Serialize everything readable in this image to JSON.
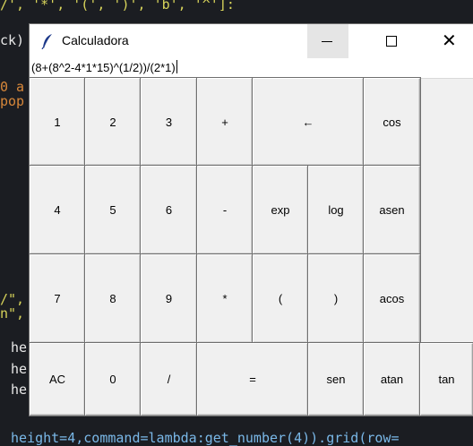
{
  "background_editor": {
    "line1": "/', '*', '(', ')', 'b', '^']:",
    "line2": "ck)",
    "line3": "0 a",
    "line4": "pop",
    "line5": "/\",",
    "line6": "n\",",
    "line7": "he",
    "line8": "he",
    "line9": "he",
    "line10": "height=4,command=lambda:get_number(4)).grid(row="
  },
  "window": {
    "title": "Calculadora",
    "close_symbol": "✕"
  },
  "display": {
    "value": "(8+(8^2-4*1*15)^(1/2))/(2*1)"
  },
  "keys": {
    "k1": "1",
    "k2": "2",
    "k3": "3",
    "plus": "+",
    "backspace": "←",
    "cos": "cos",
    "k4": "4",
    "k5": "5",
    "k6": "6",
    "minus": "-",
    "exp": "exp",
    "log": "log",
    "asen": "asen",
    "k7": "7",
    "k8": "8",
    "k9": "9",
    "times": "*",
    "lparen": "(",
    "rparen": ")",
    "acos": "acos",
    "ac": "AC",
    "k0": "0",
    "divide": "/",
    "equals": "=",
    "sen": "sen",
    "atan": "atan",
    "tan": "tan"
  },
  "colors": {
    "editor_bg": "#1b1d22",
    "button_face": "#f0f0f0",
    "minimize_hover": "#e5e5e5"
  }
}
